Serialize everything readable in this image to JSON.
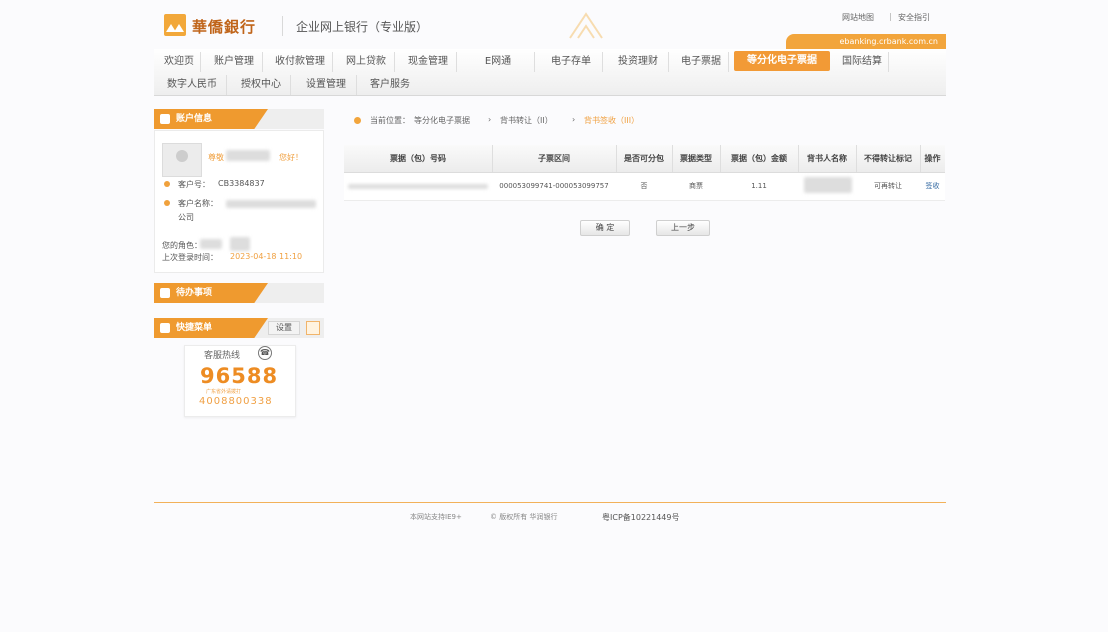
{
  "header": {
    "bank_name": "華僑銀行",
    "system_title": "企业网上银行（专业版）",
    "links": [
      "网站地图",
      "安全指引"
    ],
    "domain": "ebanking.crbank.com.cn"
  },
  "nav": {
    "row1": [
      "欢迎页",
      "账户管理",
      "收付款管理",
      "网上贷款",
      "现金管理",
      "E网通",
      "电子存单",
      "投资理财",
      "电子票据",
      "等分化电子票据",
      "国际结算"
    ],
    "row2": [
      "数字人民币",
      "授权中心",
      "设置管理",
      "客户服务"
    ],
    "active": "等分化电子票据"
  },
  "account_panel": {
    "title": "账户信息",
    "greeting_prefix": "尊敬",
    "greeting_suffix": "您好！",
    "customer_no_label": "客户号：",
    "customer_no": "CB3384837",
    "customer_name_label": "客户名称：",
    "customer_name_tail": "公司",
    "role_label": "您的角色：",
    "last_login_label": "上次登录时间：",
    "last_login": "2023-04-18 11:10"
  },
  "todo_panel": {
    "title": "待办事项"
  },
  "hotline_panel": {
    "title": "快捷菜单",
    "settings_label": "设置",
    "hotline_label": "客服热线",
    "hotline_number": "96588",
    "hotline_note": "广东省外请拨打",
    "hotline_alt": "4008800338"
  },
  "breadcrumb": [
    "当前位置：",
    "等分化电子票据",
    "背书转让（II）",
    "背书签收（III）"
  ],
  "table": {
    "headers": [
      "票据（包）号码",
      "子票区间",
      "是否可分包",
      "票据类型",
      "票据（包）金额",
      "背书人名称",
      "不得转让标记",
      "操作"
    ],
    "rows": [
      [
        "",
        "000053099741-000053099757",
        "否",
        "商票",
        "1.11",
        "",
        "可再转让",
        "签收"
      ]
    ]
  },
  "actions": {
    "confirm": "确 定",
    "back": "上一步"
  },
  "footer": {
    "browser_tip": "本网站支持IE9+",
    "copyright": "© 版权所有 华润银行",
    "icp": "粤ICP备10221449号"
  }
}
